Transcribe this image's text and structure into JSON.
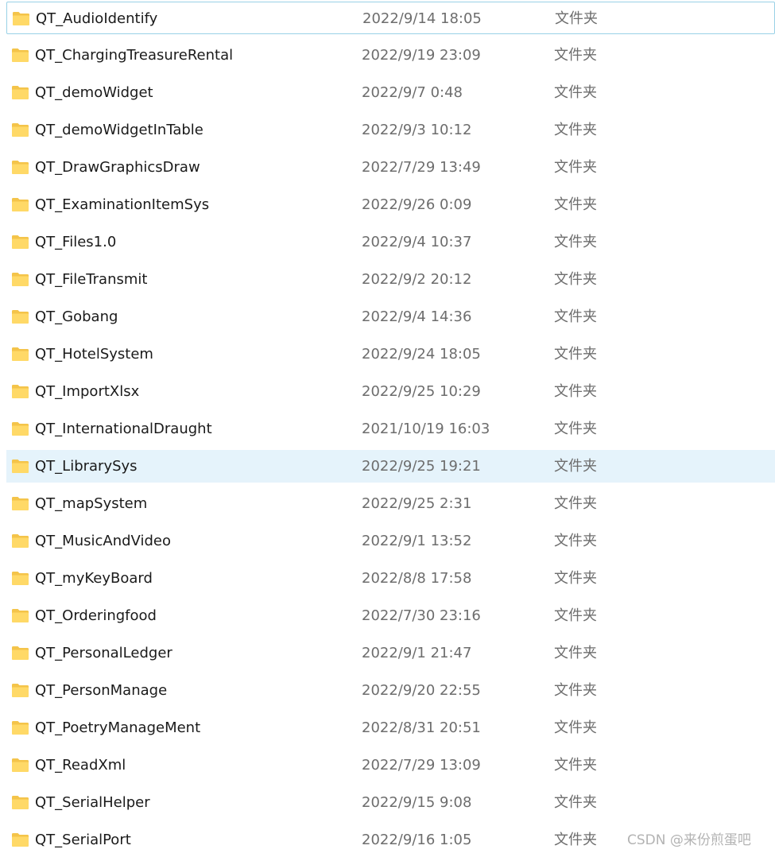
{
  "file_list": {
    "items": [
      {
        "name": "QT_AudioIdentify",
        "date": "2022/9/14 18:05",
        "type": "文件夹",
        "icon": "folder-icon",
        "state": "focused"
      },
      {
        "name": "QT_ChargingTreasureRental",
        "date": "2022/9/19 23:09",
        "type": "文件夹",
        "icon": "folder-icon",
        "state": ""
      },
      {
        "name": "QT_demoWidget",
        "date": "2022/9/7 0:48",
        "type": "文件夹",
        "icon": "folder-icon",
        "state": ""
      },
      {
        "name": "QT_demoWidgetInTable",
        "date": "2022/9/3 10:12",
        "type": "文件夹",
        "icon": "folder-icon",
        "state": ""
      },
      {
        "name": "QT_DrawGraphicsDraw",
        "date": "2022/7/29 13:49",
        "type": "文件夹",
        "icon": "folder-icon",
        "state": ""
      },
      {
        "name": "QT_ExaminationItemSys",
        "date": "2022/9/26 0:09",
        "type": "文件夹",
        "icon": "folder-icon",
        "state": ""
      },
      {
        "name": "QT_Files1.0",
        "date": "2022/9/4 10:37",
        "type": "文件夹",
        "icon": "folder-icon",
        "state": ""
      },
      {
        "name": "QT_FileTransmit",
        "date": "2022/9/2 20:12",
        "type": "文件夹",
        "icon": "folder-icon",
        "state": ""
      },
      {
        "name": "QT_Gobang",
        "date": "2022/9/4 14:36",
        "type": "文件夹",
        "icon": "folder-icon",
        "state": ""
      },
      {
        "name": "QT_HotelSystem",
        "date": "2022/9/24 18:05",
        "type": "文件夹",
        "icon": "folder-icon",
        "state": ""
      },
      {
        "name": "QT_ImportXlsx",
        "date": "2022/9/25 10:29",
        "type": "文件夹",
        "icon": "folder-icon",
        "state": ""
      },
      {
        "name": "QT_InternationalDraught",
        "date": "2021/10/19 16:03",
        "type": "文件夹",
        "icon": "folder-icon",
        "state": ""
      },
      {
        "name": "QT_LibrarySys",
        "date": "2022/9/25 19:21",
        "type": "文件夹",
        "icon": "folder-icon",
        "state": "hovered"
      },
      {
        "name": "QT_mapSystem",
        "date": "2022/9/25 2:31",
        "type": "文件夹",
        "icon": "folder-icon",
        "state": ""
      },
      {
        "name": "QT_MusicAndVideo",
        "date": "2022/9/1 13:52",
        "type": "文件夹",
        "icon": "folder-icon",
        "state": ""
      },
      {
        "name": "QT_myKeyBoard",
        "date": "2022/8/8 17:58",
        "type": "文件夹",
        "icon": "folder-icon",
        "state": ""
      },
      {
        "name": "QT_Orderingfood",
        "date": "2022/7/30 23:16",
        "type": "文件夹",
        "icon": "folder-icon",
        "state": ""
      },
      {
        "name": "QT_PersonalLedger",
        "date": "2022/9/1 21:47",
        "type": "文件夹",
        "icon": "folder-icon",
        "state": ""
      },
      {
        "name": "QT_PersonManage",
        "date": "2022/9/20 22:55",
        "type": "文件夹",
        "icon": "folder-icon",
        "state": ""
      },
      {
        "name": "QT_PoetryManageMent",
        "date": "2022/8/31 20:51",
        "type": "文件夹",
        "icon": "folder-icon",
        "state": ""
      },
      {
        "name": "QT_ReadXml",
        "date": "2022/7/29 13:09",
        "type": "文件夹",
        "icon": "folder-icon",
        "state": ""
      },
      {
        "name": "QT_SerialHelper",
        "date": "2022/9/15 9:08",
        "type": "文件夹",
        "icon": "folder-icon",
        "state": ""
      },
      {
        "name": "QT_SerialPort",
        "date": "2022/9/16 1:05",
        "type": "文件夹",
        "icon": "folder-icon",
        "state": ""
      }
    ]
  },
  "colors": {
    "folder_back": "#f4c44a",
    "folder_front": "#ffd967",
    "hover_background": "#e5f3fb",
    "focus_border": "#99d1e6"
  },
  "watermark": {
    "text": "CSDN @来份煎蛋吧"
  }
}
